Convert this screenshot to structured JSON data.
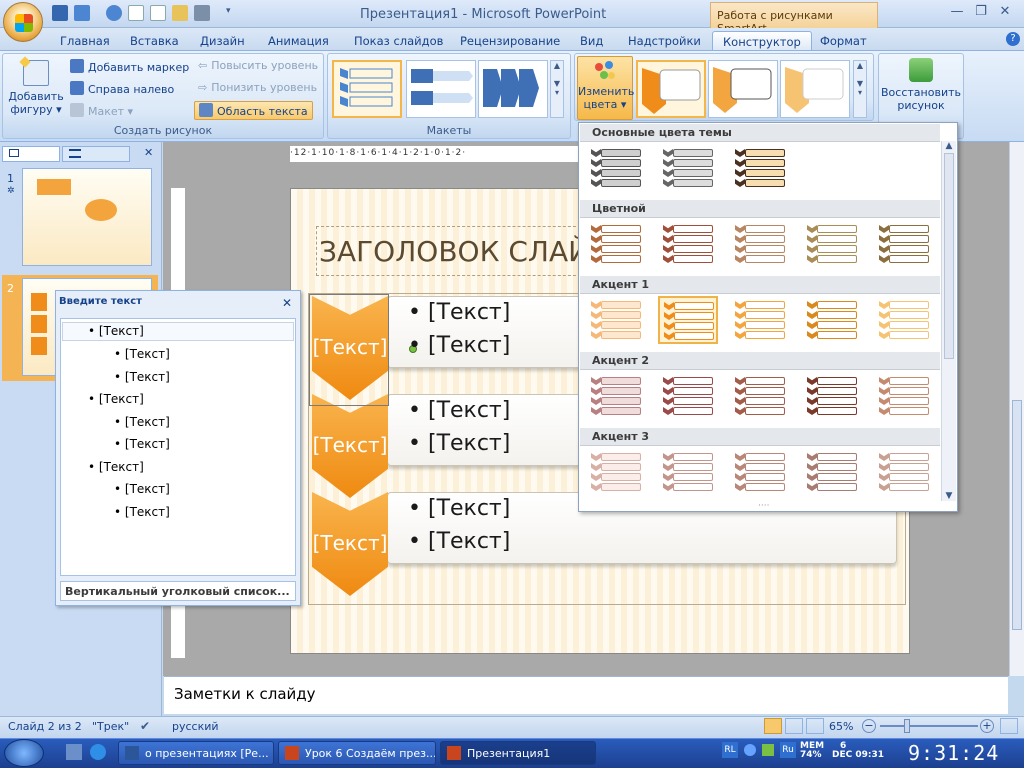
{
  "titlebar": {
    "doc": "Презентация1",
    "sep": "-",
    "app": "Microsoft PowerPoint",
    "ctx_title": "Работа с рисунками SmartArt"
  },
  "tabs": [
    "Главная",
    "Вставка",
    "Дизайн",
    "Анимация",
    "Показ слайдов",
    "Рецензирование",
    "Вид",
    "Надстройки",
    "Конструктор",
    "Формат"
  ],
  "active_tab": "Конструктор",
  "ribbon": {
    "create": {
      "add_shape": "Добавить",
      "add_shape2": "фигуру",
      "add_bullet": "Добавить маркер",
      "rtl": "Справа налево",
      "layout": "Макет",
      "promote": "Повысить уровень",
      "demote": "Понизить уровень",
      "text_pane": "Область текста",
      "label": "Создать рисунок"
    },
    "layouts": {
      "label": "Макеты"
    },
    "colors": {
      "change1": "Изменить",
      "change2": "цвета"
    },
    "reset": {
      "l1": "Восстановить",
      "l2": "рисунок"
    }
  },
  "slides": [
    {
      "num": "1"
    },
    {
      "num": "2"
    }
  ],
  "slide": {
    "title": "ЗАГОЛОВОК СЛАЙДА",
    "chevrons": [
      "[Текст]",
      "[Текст]",
      "[Текст]"
    ],
    "bullets": [
      "[Текст]",
      "[Текст]",
      "[Текст]",
      "[Текст]",
      "[Текст]",
      "[Текст]"
    ]
  },
  "ruler_text": "·12·1·10·1·8·1·6·1·4·1·2·1·0·1·2·",
  "text_pane": {
    "title": "Введите текст",
    "items": [
      {
        "level": 1,
        "text": "[Текст]"
      },
      {
        "level": 2,
        "text": "[Текст]"
      },
      {
        "level": 2,
        "text": "[Текст]"
      },
      {
        "level": 1,
        "text": "[Текст]"
      },
      {
        "level": 2,
        "text": "[Текст]"
      },
      {
        "level": 2,
        "text": "[Текст]"
      },
      {
        "level": 1,
        "text": "[Текст]"
      },
      {
        "level": 2,
        "text": "[Текст]"
      },
      {
        "level": 2,
        "text": "[Текст]"
      }
    ],
    "footer": "Вертикальный уголковый список..."
  },
  "color_menu": {
    "sections": [
      "Основные цвета темы",
      "Цветной",
      "Акцент 1",
      "Акцент 2",
      "Акцент 3"
    ]
  },
  "notes": "Заметки к слайду",
  "status": {
    "slide": "Слайд 2 из 2",
    "theme": "\"Трек\"",
    "lang": "русский",
    "zoom": "65%"
  },
  "taskbar": {
    "items": [
      "о презентациях [Ре...",
      "Урок 6 Создаём през...",
      "Презентация1"
    ],
    "tray_rl": "RL",
    "tray_ru": "Ru",
    "mem_label": "MEM",
    "mem_val": "74%",
    "date_day": "6",
    "date_rest": "DEC 09:31",
    "clock": "9:31:24"
  },
  "colors": {
    "accent": "#f08c1a",
    "ribbon": "#dbe8f7"
  }
}
